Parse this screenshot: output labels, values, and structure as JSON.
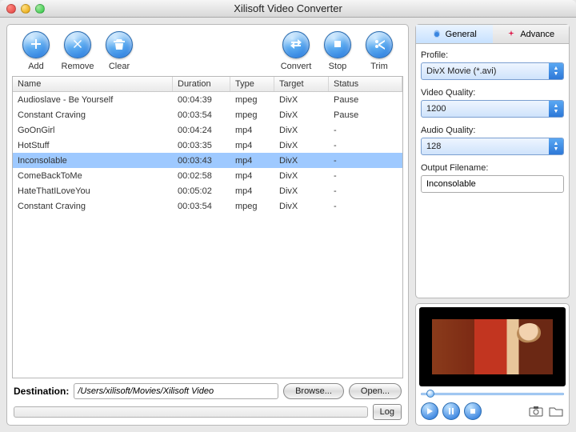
{
  "window": {
    "title": "Xilisoft Video Converter"
  },
  "toolbar": {
    "add": "Add",
    "remove": "Remove",
    "clear": "Clear",
    "convert": "Convert",
    "stop": "Stop",
    "trim": "Trim"
  },
  "table": {
    "headers": {
      "name": "Name",
      "duration": "Duration",
      "type": "Type",
      "target": "Target",
      "status": "Status"
    },
    "rows": [
      {
        "name": "Audioslave - Be Yourself",
        "duration": "00:04:39",
        "type": "mpeg",
        "target": "DivX",
        "status": "Pause",
        "selected": false
      },
      {
        "name": "Constant Craving",
        "duration": "00:03:54",
        "type": "mpeg",
        "target": "DivX",
        "status": "Pause",
        "selected": false
      },
      {
        "name": "GoOnGirl",
        "duration": "00:04:24",
        "type": "mp4",
        "target": "DivX",
        "status": "-",
        "selected": false
      },
      {
        "name": "HotStuff",
        "duration": "00:03:35",
        "type": "mp4",
        "target": "DivX",
        "status": "-",
        "selected": false
      },
      {
        "name": "Inconsolable",
        "duration": "00:03:43",
        "type": "mp4",
        "target": "DivX",
        "status": "-",
        "selected": true
      },
      {
        "name": "ComeBackToMe",
        "duration": "00:02:58",
        "type": "mp4",
        "target": "DivX",
        "status": "-",
        "selected": false
      },
      {
        "name": "HateThatILoveYou",
        "duration": "00:05:02",
        "type": "mp4",
        "target": "DivX",
        "status": "-",
        "selected": false
      },
      {
        "name": "Constant Craving",
        "duration": "00:03:54",
        "type": "mpeg",
        "target": "DivX",
        "status": "-",
        "selected": false
      }
    ]
  },
  "destination": {
    "label": "Destination:",
    "path": "/Users/xilisoft/Movies/Xilisoft Video",
    "browse": "Browse...",
    "open": "Open..."
  },
  "statusbar": {
    "log": "Log"
  },
  "tabs": {
    "general": "General",
    "advance": "Advance"
  },
  "settings": {
    "profile_label": "Profile:",
    "profile_value": "DivX Movie  (*.avi)",
    "vq_label": "Video Quality:",
    "vq_value": "1200",
    "aq_label": "Audio Quality:",
    "aq_value": "128",
    "outname_label": "Output Filename:",
    "outname_value": "Inconsolable"
  }
}
